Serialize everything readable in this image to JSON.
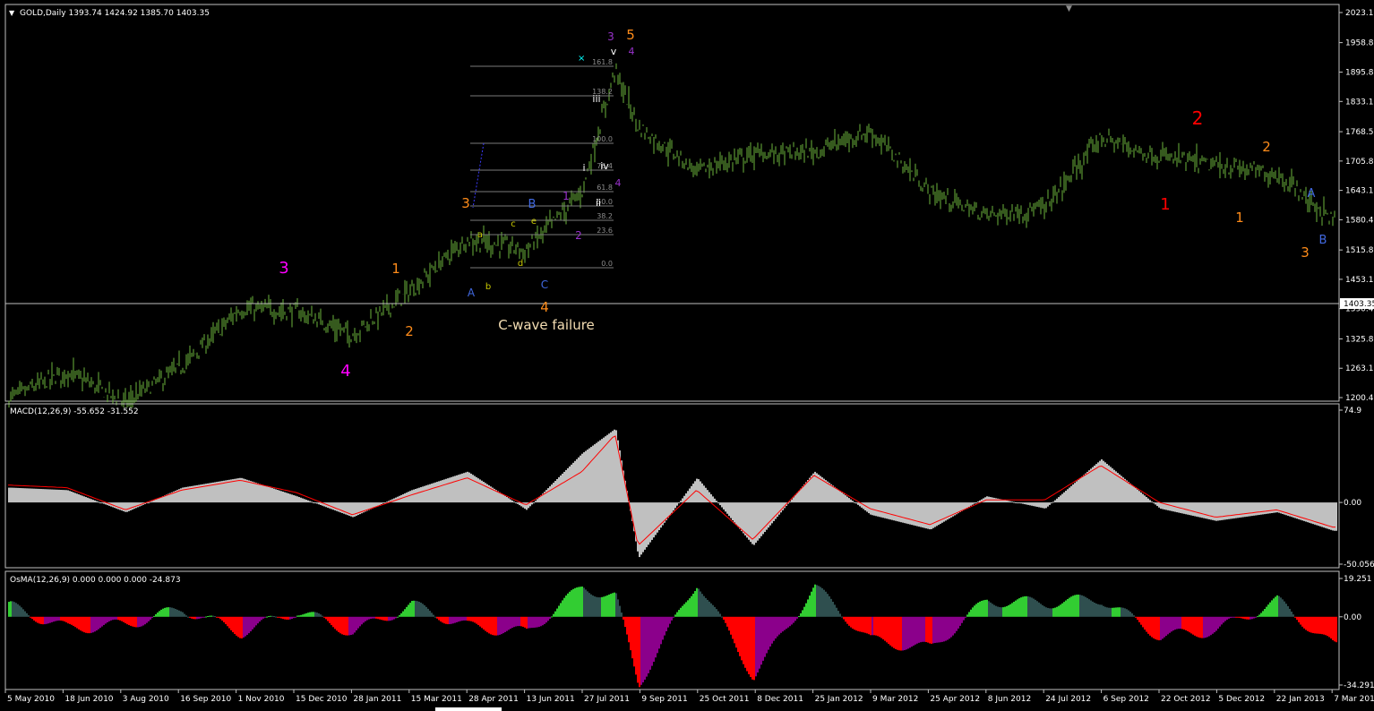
{
  "colors": {
    "background": "#000000",
    "grid_border": "#c0c0c0",
    "price_bars": "#6bb33c",
    "macd_hist": "#c0c0c0",
    "macd_signal": "#ff0000",
    "osma_up": "#32cd32",
    "osma_up_weak": "#2f4f4f",
    "osma_down": "#ff0000",
    "osma_down_weak": "#8b008b",
    "axis_text": "#ffffff"
  },
  "price_panel": {
    "header": "GOLD,Daily  1393.74 1424.92 1385.70 1403.35",
    "current_price_label": "1403.35",
    "y_ticks": [
      "2023.13",
      "1958.83",
      "1895.83",
      "1833.13",
      "1768.53",
      "1705.83",
      "1643.13",
      "1580.43",
      "1515.83",
      "1453.13",
      "1390.43",
      "1325.83",
      "1263.13",
      "1200.43"
    ]
  },
  "macd_panel": {
    "header": "MACD(12,26,9) -55.652 -31.552",
    "y_ticks": [
      "74.9",
      "0.00",
      "-50.056"
    ]
  },
  "osma_panel": {
    "header": "OsMA(12,26,9) 0.000 0.000 0.000 -24.873",
    "y_ticks": [
      "19.251",
      "0.00",
      "-34.291"
    ]
  },
  "x_ticks": [
    "5 May 2010",
    "18 Jun 2010",
    "3 Aug 2010",
    "16 Sep 2010",
    "1 Nov 2010",
    "15 Dec 2010",
    "28 Jan 2011",
    "15 Mar 2011",
    "28 Apr 2011",
    "13 Jun 2011",
    "27 Jul 2011",
    "9 Sep 2011",
    "25 Oct 2011",
    "8 Dec 2011",
    "25 Jan 2012",
    "9 Mar 2012",
    "25 Apr 2012",
    "8 Jun 2012",
    "24 Jul 2012",
    "6 Sep 2012",
    "22 Oct 2012",
    "5 Dec 2012",
    "22 Jan 2013",
    "7 Mar 2013"
  ],
  "fib_levels": [
    "161.8",
    "138.2",
    "100.0",
    "76.4",
    "61.8",
    "50.0",
    "38.2",
    "23.6",
    "0.0"
  ],
  "annotations": [
    {
      "text": "3",
      "color": "#ff00ff"
    },
    {
      "text": "4",
      "color": "#ff00ff"
    },
    {
      "text": "1",
      "color": "#ff8c1a"
    },
    {
      "text": "2",
      "color": "#ff8c1a"
    },
    {
      "text": "3",
      "color": "#ff8c1a"
    },
    {
      "text": "4",
      "color": "#ff8c1a"
    },
    {
      "text": "5",
      "color": "#ff8c1a"
    },
    {
      "text": "A",
      "color": "#4169e1"
    },
    {
      "text": "B",
      "color": "#4169e1"
    },
    {
      "text": "C",
      "color": "#4169e1"
    },
    {
      "text": "a",
      "color": "#c8c800"
    },
    {
      "text": "b",
      "color": "#c8c800"
    },
    {
      "text": "c",
      "color": "#c8c800"
    },
    {
      "text": "d",
      "color": "#c8c800"
    },
    {
      "text": "e",
      "color": "#c8c800"
    },
    {
      "text": "1",
      "color": "#9932cc"
    },
    {
      "text": "2",
      "color": "#9932cc"
    },
    {
      "text": "3",
      "color": "#9932cc"
    },
    {
      "text": "4",
      "color": "#9932cc"
    },
    {
      "text": "4",
      "color": "#9932cc"
    },
    {
      "text": "i",
      "color": "#ffffff"
    },
    {
      "text": "ii",
      "color": "#ffffff"
    },
    {
      "text": "iii",
      "color": "#ffffff"
    },
    {
      "text": "iv",
      "color": "#ffffff"
    },
    {
      "text": "v",
      "color": "#ffffff"
    },
    {
      "text": "C-wave failure",
      "color": "#f5deb3"
    },
    {
      "text": "1",
      "color": "#ff0000"
    },
    {
      "text": "2",
      "color": "#ff0000"
    },
    {
      "text": "1",
      "color": "#ff8c1a"
    },
    {
      "text": "2",
      "color": "#ff8c1a"
    },
    {
      "text": "3",
      "color": "#ff8c1a"
    },
    {
      "text": "A",
      "color": "#4169e1"
    },
    {
      "text": "B",
      "color": "#4169e1"
    }
  ],
  "chart_data": [
    {
      "type": "line",
      "title": "GOLD,Daily",
      "series": [
        {
          "name": "GOLD,Daily",
          "x": [
            "2010-05-05",
            "2010-06-18",
            "2010-08-03",
            "2010-09-16",
            "2010-11-01",
            "2010-12-15",
            "2011-01-28",
            "2011-03-15",
            "2011-04-28",
            "2011-06-13",
            "2011-07-27",
            "2011-08-22",
            "2011-09-09",
            "2011-10-25",
            "2011-12-08",
            "2012-01-25",
            "2012-03-09",
            "2012-04-25",
            "2012-06-08",
            "2012-07-24",
            "2012-09-06",
            "2012-10-22",
            "2012-12-05",
            "2013-01-22",
            "2013-03-07"
          ],
          "values": [
            1200,
            1255,
            1190,
            1265,
            1390,
            1385,
            1335,
            1430,
            1540,
            1515,
            1640,
            1900,
            1780,
            1685,
            1720,
            1725,
            1770,
            1640,
            1590,
            1605,
            1755,
            1715,
            1695,
            1680,
            1580
          ]
        }
      ],
      "ylim": [
        1200.43,
        2023.13
      ],
      "last_price": 1403.35
    },
    {
      "type": "bar",
      "title": "MACD(12,26,9)",
      "x": [
        "2010-05-05",
        "2010-06-18",
        "2010-08-03",
        "2010-09-16",
        "2010-11-01",
        "2010-12-15",
        "2011-01-28",
        "2011-03-15",
        "2011-04-28",
        "2011-06-13",
        "2011-07-27",
        "2011-08-22",
        "2011-09-09",
        "2011-10-25",
        "2011-12-08",
        "2012-01-25",
        "2012-03-09",
        "2012-04-25",
        "2012-06-08",
        "2012-07-24",
        "2012-09-06",
        "2012-10-22",
        "2012-12-05",
        "2013-01-22",
        "2013-03-07"
      ],
      "series": [
        {
          "name": "MACD",
          "values": [
            12,
            10,
            -8,
            12,
            20,
            5,
            -12,
            10,
            25,
            -6,
            40,
            60,
            -45,
            20,
            -35,
            25,
            -10,
            -22,
            5,
            -5,
            35,
            -5,
            -15,
            -8,
            -23
          ]
        },
        {
          "name": "Signal",
          "values": [
            14,
            12,
            -6,
            10,
            18,
            8,
            -10,
            6,
            20,
            -2,
            25,
            55,
            -35,
            10,
            -30,
            22,
            -5,
            -18,
            2,
            2,
            30,
            0,
            -12,
            -6,
            -20
          ]
        }
      ],
      "ylim": [
        -50.056,
        74.9
      ]
    },
    {
      "type": "bar",
      "title": "OsMA(12,26,9)",
      "x": [
        "2010-05-05",
        "2010-06-18",
        "2010-08-03",
        "2010-09-16",
        "2010-11-01",
        "2010-12-15",
        "2011-01-28",
        "2011-03-15",
        "2011-04-28",
        "2011-06-13",
        "2011-07-27",
        "2011-08-22",
        "2011-09-09",
        "2011-10-25",
        "2011-12-08",
        "2012-01-25",
        "2012-03-09",
        "2012-04-25",
        "2012-06-08",
        "2012-07-24",
        "2012-09-06",
        "2012-10-22",
        "2012-12-05",
        "2013-01-22",
        "2013-03-07"
      ],
      "values": [
        5,
        -6,
        -4,
        4,
        -8,
        3,
        -8,
        6,
        -5,
        -8,
        15,
        10,
        -34,
        18,
        -30,
        15,
        -12,
        -16,
        8,
        7,
        9,
        -10,
        -7,
        8,
        -15
      ],
      "ylim": [
        -34.291,
        19.251
      ]
    }
  ]
}
